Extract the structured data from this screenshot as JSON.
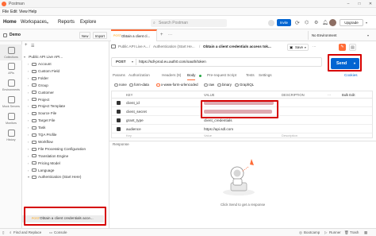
{
  "window": {
    "title": "Postman"
  },
  "menu": [
    "File",
    "Edit",
    "View",
    "Help"
  ],
  "header": {
    "nav": [
      "Home",
      "Workspaces",
      "Reports",
      "Explore"
    ],
    "search_placeholder": "Search Postman",
    "invite_label": "Invite",
    "upgrade_label": "Upgrade"
  },
  "workspace": {
    "name": "Demo",
    "new_label": "New",
    "import_label": "Import"
  },
  "tabs": [
    {
      "label": "Obtain a client cl..."
    },
    {
      "label": ""
    }
  ],
  "env": {
    "label": "No Environment"
  },
  "rail": [
    "Collections",
    "APIs",
    "Environments",
    "Mock Servers",
    "Monitors",
    "History"
  ],
  "sidebar": {
    "collection": "Public API Live API...",
    "folders": [
      "Account",
      "Custom Field",
      "Folder",
      "Group",
      "Customer",
      "Project",
      "Project Template",
      "Source File",
      "Target File",
      "Task",
      "TQA Profile",
      "Workflow",
      "File Processing Configuration",
      "Translation Engine",
      "Pricing Model",
      "Language",
      "Authentication (Start Here)"
    ],
    "request_method": "POST",
    "request_name": "Obtain a client credentials acce..."
  },
  "breadcrumb": {
    "part1": "Public API Live A...",
    "sep": "/",
    "part2": "Authentication (Start He...",
    "current": "Obtain a client credentials access tok..."
  },
  "toolbar": {
    "save_label": "Save"
  },
  "request": {
    "method": "POST",
    "url": "https://sdl-prod.eu.auth0.com/oauth/token",
    "send_label": "Send"
  },
  "req_tabs": [
    "Params",
    "Authorization",
    "Headers (9)",
    "Body",
    "Pre-request Script",
    "Tests",
    "Settings"
  ],
  "cookies_label": "Cookies",
  "body_types": [
    "none",
    "form-data",
    "x-www-form-urlencoded",
    "raw",
    "binary",
    "GraphQL"
  ],
  "params_table": {
    "headers": [
      "KEY",
      "VALUE",
      "DESCRIPTION",
      "Bulk Edit"
    ],
    "rows": [
      {
        "key": "client_id",
        "value": ""
      },
      {
        "key": "client_secret",
        "value": ""
      },
      {
        "key": "grant_type",
        "value": "client_credentials"
      },
      {
        "key": "audience",
        "value": "https://api.sdl.com"
      }
    ],
    "placeholder_key": "Key",
    "placeholder_value": "Value",
    "placeholder_desc": "Description"
  },
  "response": {
    "label": "Response",
    "hint": "Click Send to get a response"
  },
  "footer": {
    "find_replace": "Find and Replace",
    "console": "Console",
    "bootcamp": "Bootcamp",
    "runner": "Runner",
    "trash": "Trash"
  },
  "colors": {
    "accent": "#ff6c37",
    "send": "#0265d2",
    "highlight": "#d50000"
  }
}
